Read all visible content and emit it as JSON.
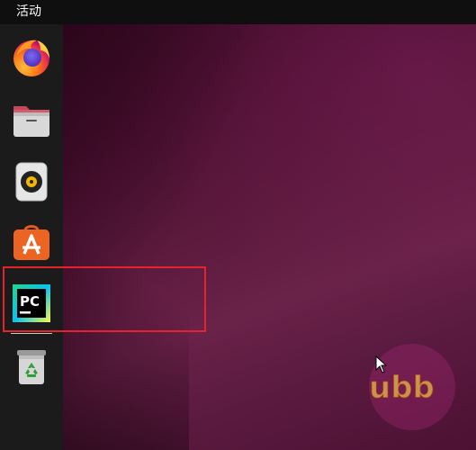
{
  "topbar": {
    "activities_label": "活动"
  },
  "dock": {
    "items": [
      {
        "name": "firefox",
        "icon": "firefox-icon"
      },
      {
        "name": "files",
        "icon": "folder-icon"
      },
      {
        "name": "rhythmbox",
        "icon": "speaker-icon"
      },
      {
        "name": "software",
        "icon": "app-store-icon"
      },
      {
        "name": "pycharm",
        "icon": "pycharm-icon",
        "icon_text": "PC"
      },
      {
        "name": "trash",
        "icon": "trash-icon"
      }
    ]
  },
  "colors": {
    "highlight": "#e3242b",
    "dock_background": "#1b1b1b",
    "topbar_background": "#0f0f0f",
    "wallpaper": "#5c1a3d"
  },
  "watermark": {
    "text": "ubb"
  }
}
